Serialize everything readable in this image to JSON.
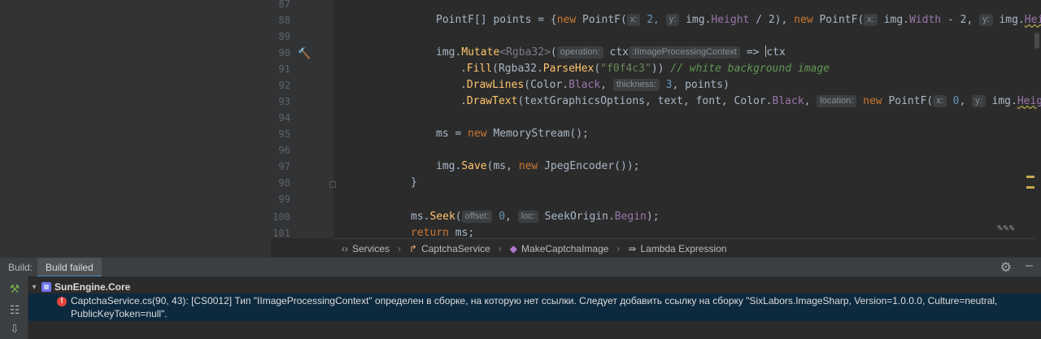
{
  "editor": {
    "lines": [
      {
        "no": "87"
      },
      {
        "no": "88"
      },
      {
        "no": "89"
      },
      {
        "no": "90"
      },
      {
        "no": "91"
      },
      {
        "no": "92"
      },
      {
        "no": "93"
      },
      {
        "no": "94"
      },
      {
        "no": "95"
      },
      {
        "no": "96"
      },
      {
        "no": "97"
      },
      {
        "no": "98"
      },
      {
        "no": "99"
      },
      {
        "no": "100"
      },
      {
        "no": "101"
      }
    ],
    "code": {
      "l88_a": "PointF[] points = {",
      "l88_new1": "new",
      "l88_b": " PointF(",
      "l88_hint_x": "x:",
      "l88_c": " 2, ",
      "l88_hint_y": "y:",
      "l88_d": " img.",
      "l88_height": "Height",
      "l88_e": " / 2), ",
      "l88_new2": "new",
      "l88_f": " PointF(",
      "l88_hint_x2": "x:",
      "l88_g": " img.",
      "l88_width": "Width",
      "l88_h": " - 2, ",
      "l88_hint_y2": "y:",
      "l88_i": " img.",
      "l88_heig": "Heigh",
      "l90_a": "img.",
      "l90_mutate": "Mutate",
      "l90_generic": "<Rgba32>",
      "l90_paren": "(",
      "l90_hint_op": "operation:",
      "l90_ctx": "ctx",
      "l90_hint_type": ":IImageProcessingContext",
      "l90_arrow": " => ",
      "l90_ctx2": "ctx",
      "l91_dot": ".",
      "l91_fill": "Fill",
      "l91_a": "(Rgba32.",
      "l91_parse": "ParseHex",
      "l91_b": "(",
      "l91_str": "\"f0f4c3\"",
      "l91_c": ")) ",
      "l91_comment": "// white background image",
      "l92_dot": ".",
      "l92_draw": "DrawLines",
      "l92_a": "(Color.",
      "l92_black": "Black",
      "l92_b": ", ",
      "l92_hint": "thickness:",
      "l92_num": " 3",
      "l92_c": ", points)",
      "l93_dot": ".",
      "l93_draw": "DrawText",
      "l93_a": "(textGraphicsOptions, text, font, Color.",
      "l93_black": "Black",
      "l93_b": ", ",
      "l93_hint": "location:",
      "l93_new": " new",
      "l93_c": " PointF(",
      "l93_hint_x": "x:",
      "l93_num": " 0",
      "l93_d": ", ",
      "l93_hint_y": "y:",
      "l93_e": " img.",
      "l93_heig": "Heigh",
      "l95_a": "ms = ",
      "l95_new": "new",
      "l95_b": " MemoryStream();",
      "l97_a": "img.",
      "l97_save": "Save",
      "l97_b": "(ms, ",
      "l97_new": "new",
      "l97_c": " JpegEncoder());",
      "l98": "}",
      "l100_a": "ms.",
      "l100_seek": "Seek",
      "l100_b": "(",
      "l100_hint": "offset:",
      "l100_num": " 0",
      "l100_c": ", ",
      "l100_hint2": "loc:",
      "l100_d": " SeekOrigin.",
      "l100_begin": "Begin",
      "l100_e": ");",
      "l101_kw": "return",
      "l101_a": " ms;"
    }
  },
  "breadcrumb": {
    "items": [
      {
        "icon": "namespace-icon",
        "label": "Services"
      },
      {
        "icon": "class-icon",
        "label": "CaptchaService"
      },
      {
        "icon": "method-icon",
        "label": "MakeCaptchaImage"
      },
      {
        "icon": "lambda-icon",
        "label": "Lambda Expression"
      }
    ]
  },
  "build_panel": {
    "label": "Build:",
    "tab": "Build failed",
    "project": "SunEngine.Core",
    "error_text": "CaptchaService.cs(90, 43): [CS0012] Тип \"IImageProcessingContext\" определен в сборке, на которую нет ссылки. Следует добавить ссылку на сборку \"SixLabors.ImageSharp, Version=1.0.0.0, Culture=neutral, PublicKeyToken=null\"."
  },
  "icons": {
    "namespace": "‹›",
    "class_arrow": "↱",
    "method": "◆",
    "lambda": "⇛",
    "gear": "⚙",
    "minimize": "–",
    "hammer": "🔨",
    "chevron": "▾",
    "error": "!"
  },
  "colors": {
    "background": "#2b2b2b",
    "keyword": "#cc7832",
    "method": "#ffc66d",
    "number": "#6897bb",
    "string": "#6a8759",
    "comment": "#629755",
    "error_row": "#0d293e",
    "error_icon": "#e0433a"
  }
}
